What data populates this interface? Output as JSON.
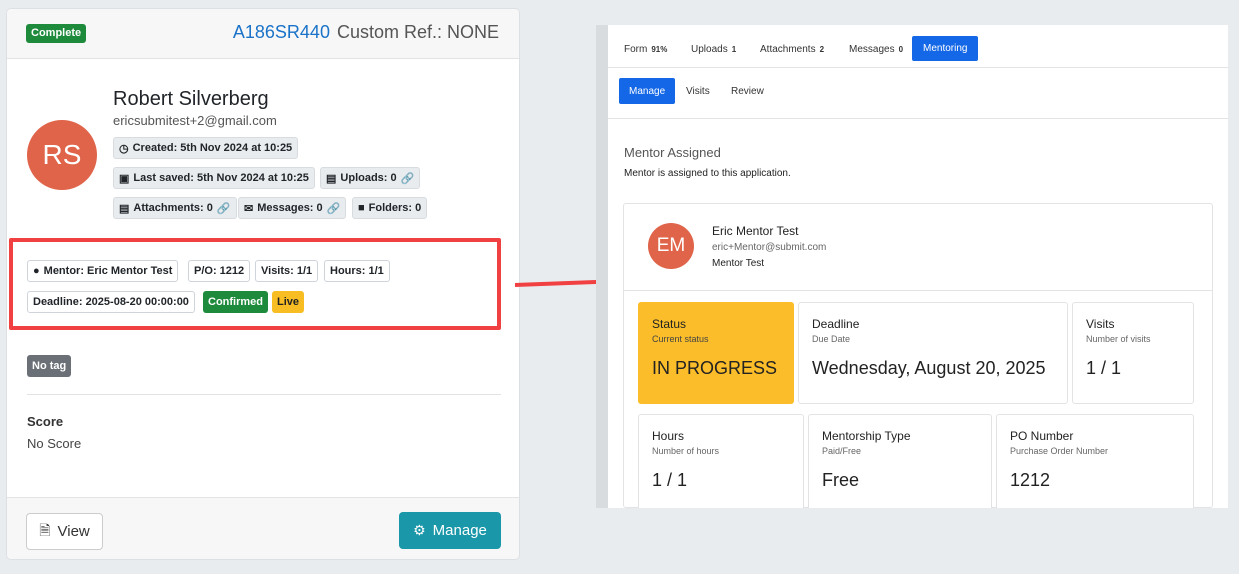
{
  "card": {
    "status_badge": "Complete",
    "ref_id": "A186SR440",
    "custom_ref": "Custom Ref.: NONE",
    "avatar_initials": "RS",
    "name": "Robert Silverberg",
    "email": "ericsubmitest+2@gmail.com",
    "created": "Created: 5th Nov 2024 at 10:25",
    "last_saved": "Last saved: 5th Nov 2024 at 10:25",
    "uploads": "Uploads: 0",
    "attachments": "Attachments: 0",
    "messages": "Messages: 0",
    "folders": "Folders: 0",
    "mentor_chip": "Mentor:  Eric Mentor Test",
    "po_chip": "P/O:  1212",
    "visits_chip": "Visits:  1/1",
    "hours_chip": "Hours:  1/1",
    "deadline_chip": "Deadline:  2025-08-20 00:00:00",
    "confirmed_badge": "Confirmed",
    "live_badge": "Live",
    "tag_badge": "No tag",
    "score_label": "Score",
    "score_value": "No Score",
    "view_button": "View",
    "manage_button": "Manage"
  },
  "panel": {
    "tabs": [
      {
        "label": "Form",
        "count": "91%"
      },
      {
        "label": "Uploads",
        "count": "1"
      },
      {
        "label": "Attachments",
        "count": "2"
      },
      {
        "label": "Messages",
        "count": "0"
      },
      {
        "label": "Mentoring",
        "count": ""
      }
    ],
    "subtabs": [
      "Manage",
      "Visits",
      "Review"
    ],
    "mentor_title": "Mentor Assigned",
    "mentor_sub": "Mentor is assigned to this application.",
    "mentor": {
      "initials": "EM",
      "name": "Eric Mentor Test",
      "email": "eric+Mentor@submit.com",
      "role": "Mentor Test"
    },
    "tiles": [
      {
        "label": "Status",
        "sub": "Current status",
        "value": "IN PROGRESS"
      },
      {
        "label": "Deadline",
        "sub": "Due Date",
        "value": "Wednesday, August 20, 2025"
      },
      {
        "label": "Visits",
        "sub": "Number of visits",
        "value": "1 / 1"
      },
      {
        "label": "Hours",
        "sub": "Number of hours",
        "value": "1 / 1"
      },
      {
        "label": "Mentorship Type",
        "sub": "Paid/Free",
        "value": "Free"
      },
      {
        "label": "PO Number",
        "sub": "Purchase Order Number",
        "value": "1212"
      }
    ]
  },
  "colors": {
    "highlight": "#f04042",
    "accent_blue": "#1467e6",
    "manage_teal": "#1a97a8",
    "status_yellow": "#fbbd29",
    "avatar": "#e0644a"
  },
  "icons": [
    "clock-icon",
    "save-icon",
    "file-upload-icon",
    "link-icon",
    "paperclip-icon",
    "envelope-icon",
    "folder-icon",
    "user-icon",
    "document-icon",
    "gear-icon",
    "arrow-right-icon"
  ]
}
